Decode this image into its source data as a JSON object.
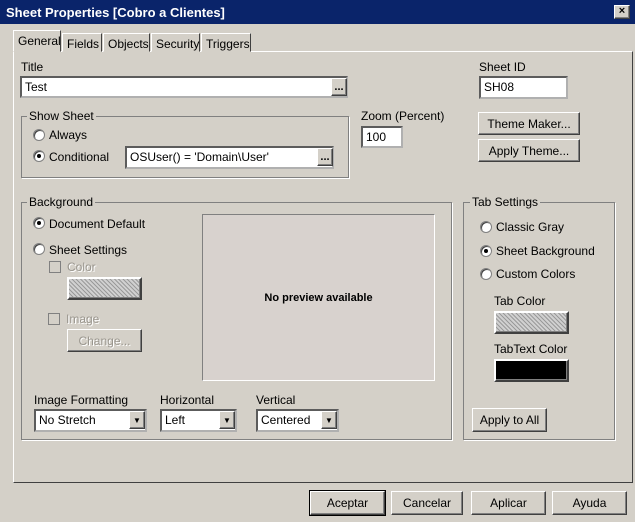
{
  "window": {
    "title": "Sheet Properties [Cobro a Clientes]",
    "close": "×"
  },
  "tabs": [
    "General",
    "Fields",
    "Objects",
    "Security",
    "Triggers"
  ],
  "general": {
    "title_label": "Title",
    "title_value": "Test",
    "dots": "...",
    "sheet_id_label": "Sheet ID",
    "sheet_id_value": "SH08",
    "show_sheet": {
      "label": "Show Sheet",
      "always": "Always",
      "conditional": "Conditional",
      "condition_value": "OSUser() = 'Domain\\User'",
      "selected": "Conditional"
    },
    "zoom_label": "Zoom (Percent)",
    "zoom_value": "100",
    "theme_maker": "Theme Maker...",
    "apply_theme": "Apply Theme...",
    "background": {
      "label": "Background",
      "document_default": "Document Default",
      "sheet_settings": "Sheet Settings",
      "color": "Color",
      "image": "Image",
      "change": "Change...",
      "preview": "No preview available",
      "selected": "Document Default"
    },
    "image_formatting": {
      "label": "Image Formatting",
      "value": "No Stretch"
    },
    "horizontal": {
      "label": "Horizontal",
      "value": "Left"
    },
    "vertical": {
      "label": "Vertical",
      "value": "Centered"
    },
    "tab_settings": {
      "label": "Tab Settings",
      "classic_gray": "Classic Gray",
      "sheet_background": "Sheet Background",
      "custom_colors": "Custom Colors",
      "tab_color": "Tab Color",
      "tabtext_color": "TabText Color",
      "apply_all": "Apply to All",
      "selected": "Sheet Background",
      "tabtext_color_value": "#000000"
    }
  },
  "footer": {
    "ok": "Aceptar",
    "cancel": "Cancelar",
    "apply": "Aplicar",
    "help": "Ayuda"
  }
}
